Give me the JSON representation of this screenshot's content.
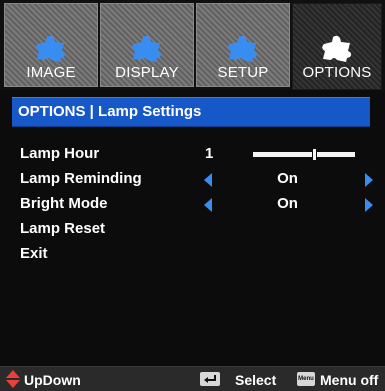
{
  "tabs": [
    {
      "label": "IMAGE",
      "icon": "puzzle-piece-icon",
      "active": false
    },
    {
      "label": "DISPLAY",
      "icon": "puzzle-piece-icon",
      "active": false
    },
    {
      "label": "SETUP",
      "icon": "puzzle-piece-icon",
      "active": false
    },
    {
      "label": "OPTIONS",
      "icon": "puzzle-piece-icon",
      "active": true
    }
  ],
  "title": "OPTIONS | Lamp Settings",
  "menu": {
    "lamp_hour": {
      "label": "Lamp Hour",
      "value": "1",
      "slider_fraction": 0.6
    },
    "lamp_reminding": {
      "label": "Lamp Reminding",
      "value": "On"
    },
    "bright_mode": {
      "label": "Bright Mode",
      "value": "On"
    },
    "lamp_reset": {
      "label": "Lamp Reset"
    },
    "exit": {
      "label": "Exit"
    }
  },
  "hints": {
    "updown": "UpDown",
    "select": "Select",
    "menu_off": "Menu off",
    "menu_key_text": "Menu"
  },
  "colors": {
    "title_bar": "#1758c8",
    "arrow": "#3a8df0",
    "icon_inactive": "#3a8df0",
    "icon_active": "#ffffff",
    "updown_icon": "#e8403a"
  }
}
